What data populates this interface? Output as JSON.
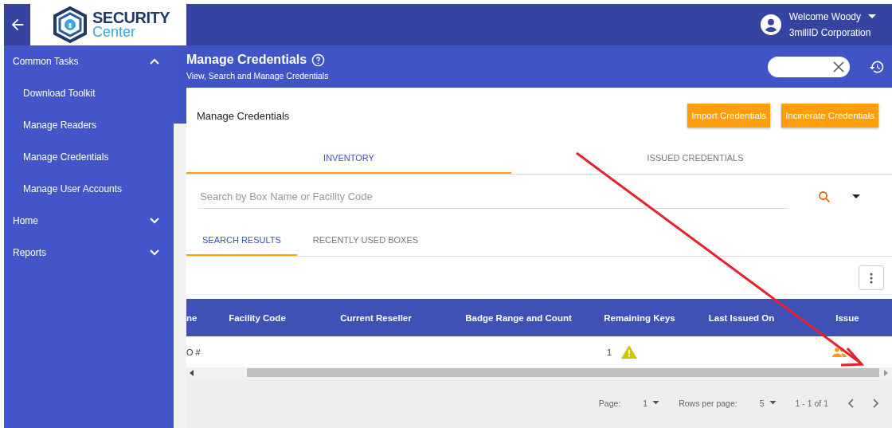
{
  "logo": {
    "line_1": "SECURITY",
    "line_2": "Center"
  },
  "user": {
    "greeting": "Welcome Woody",
    "company": "3millID Corporation"
  },
  "sidebar": {
    "items": [
      {
        "label": "Common Tasks",
        "expanded": true,
        "children": [
          {
            "label": "Download Toolkit"
          },
          {
            "label": "Manage Readers"
          },
          {
            "label": "Manage Credentials"
          },
          {
            "label": "Manage User Accounts"
          }
        ]
      },
      {
        "label": "Home",
        "expanded": false
      },
      {
        "label": "Reports",
        "expanded": false
      }
    ]
  },
  "page_header": {
    "title": "Manage Credentials",
    "subtitle": "View, Search and Manage Credentials"
  },
  "card": {
    "title": "Manage Credentials",
    "buttons": [
      "Import Credentials",
      "Incinerate Credentials"
    ],
    "tabs": [
      {
        "label": "INVENTORY",
        "selected": true
      },
      {
        "label": "ISSUED CREDENTIALS",
        "selected": false
      }
    ],
    "search": {
      "placeholder": "Search by Box Name or Facility Code"
    },
    "sub_tabs": [
      {
        "label": "SEARCH RESULTS",
        "selected": true
      },
      {
        "label": "RECENTLY USED BOXES",
        "selected": false
      }
    ]
  },
  "table": {
    "columns": [
      "ne",
      "Facility Code",
      "Current Reseller",
      "Badge Range and Count",
      "Remaining Keys",
      "Last Issued On",
      "Issue"
    ],
    "rows": [
      {
        "column_1": "O #",
        "remaining_keys": "1",
        "warning": true
      }
    ]
  },
  "pagination": {
    "page_label": "Page:",
    "page": "1",
    "rows_label": "Rows per page:",
    "rows": "5",
    "range": "1 - 1 of 1"
  }
}
